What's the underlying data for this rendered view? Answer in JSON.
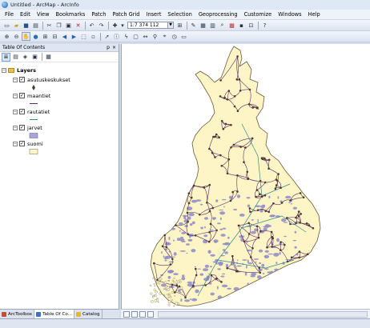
{
  "window": {
    "title": "Untitled - ArcMap - ArcInfo"
  },
  "menu": [
    "File",
    "Edit",
    "View",
    "Bookmarks",
    "Patch",
    "Patch Grid",
    "Insert",
    "Selection",
    "Geoprocessing",
    "Customize",
    "Windows",
    "Help"
  ],
  "toolbar": {
    "scale": "1:7 374 112"
  },
  "toc": {
    "title": "Table Of Contents",
    "pin": "p",
    "close": "×",
    "root_label": "Layers",
    "layers": [
      {
        "name": "asutuskeskukset",
        "symbol": "point"
      },
      {
        "name": "maantiet",
        "symbol": "line"
      },
      {
        "name": "rautatiet",
        "symbol": "rail"
      },
      {
        "name": "jarvet",
        "symbol": "lake"
      },
      {
        "name": "suomi",
        "symbol": "land"
      }
    ]
  },
  "bottom_tabs": [
    "ArcToolbox",
    "Table Of Co...",
    "Catalog"
  ],
  "colors": {
    "land": "#fdf5c6",
    "lakes": "#8d88c8",
    "roads": "#5a2a6a",
    "rail": "#2f8a8a",
    "points": "#4b3b2b"
  },
  "icons": [
    "new-icon",
    "open-icon",
    "save-icon",
    "print-icon",
    "cut-icon",
    "copy-icon",
    "paste-icon",
    "delete-icon",
    "undo-icon",
    "redo-icon",
    "add-data-icon",
    "zoom-in-icon",
    "zoom-out-icon",
    "pan-icon",
    "full-extent-icon",
    "select-icon",
    "identify-icon",
    "find-icon",
    "measure-icon",
    "hyperlink-icon",
    "editor-icon",
    "arctoolbox-icon",
    "catalog-icon",
    "python-icon",
    "help-icon"
  ]
}
